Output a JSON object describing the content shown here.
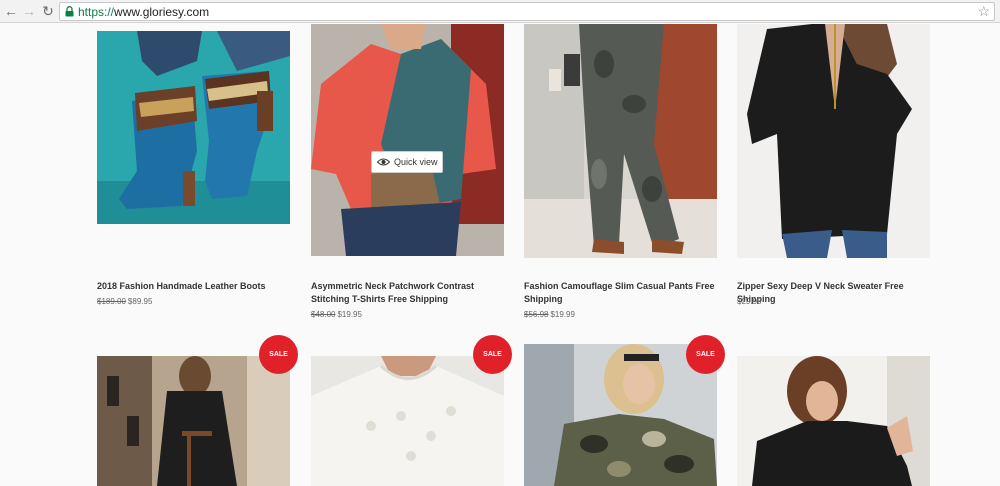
{
  "browser": {
    "url_scheme": "https://",
    "url_host": "www.gloriesy.com"
  },
  "quick_view_label": "Quick view",
  "sale_label": "SALE",
  "products_row1": [
    {
      "name": "2018 Fashion Handmade Leather Boots",
      "old_price": "$189.00",
      "price": "$89.95"
    },
    {
      "name": "Asymmetric Neck Patchwork Contrast Stitching T-Shirts Free Shipping",
      "old_price": "$48.00",
      "price": "$19.95"
    },
    {
      "name": "Fashion Camouflage Slim Casual Pants Free Shipping",
      "old_price": "$56.98",
      "price": "$19.99"
    },
    {
      "name": "Zipper Sexy Deep V Neck Sweater Free Shipping",
      "old_price": "",
      "price": "$29.95"
    }
  ],
  "colors": {
    "sale_badge": "#e0212a",
    "background": "#fafafa"
  }
}
